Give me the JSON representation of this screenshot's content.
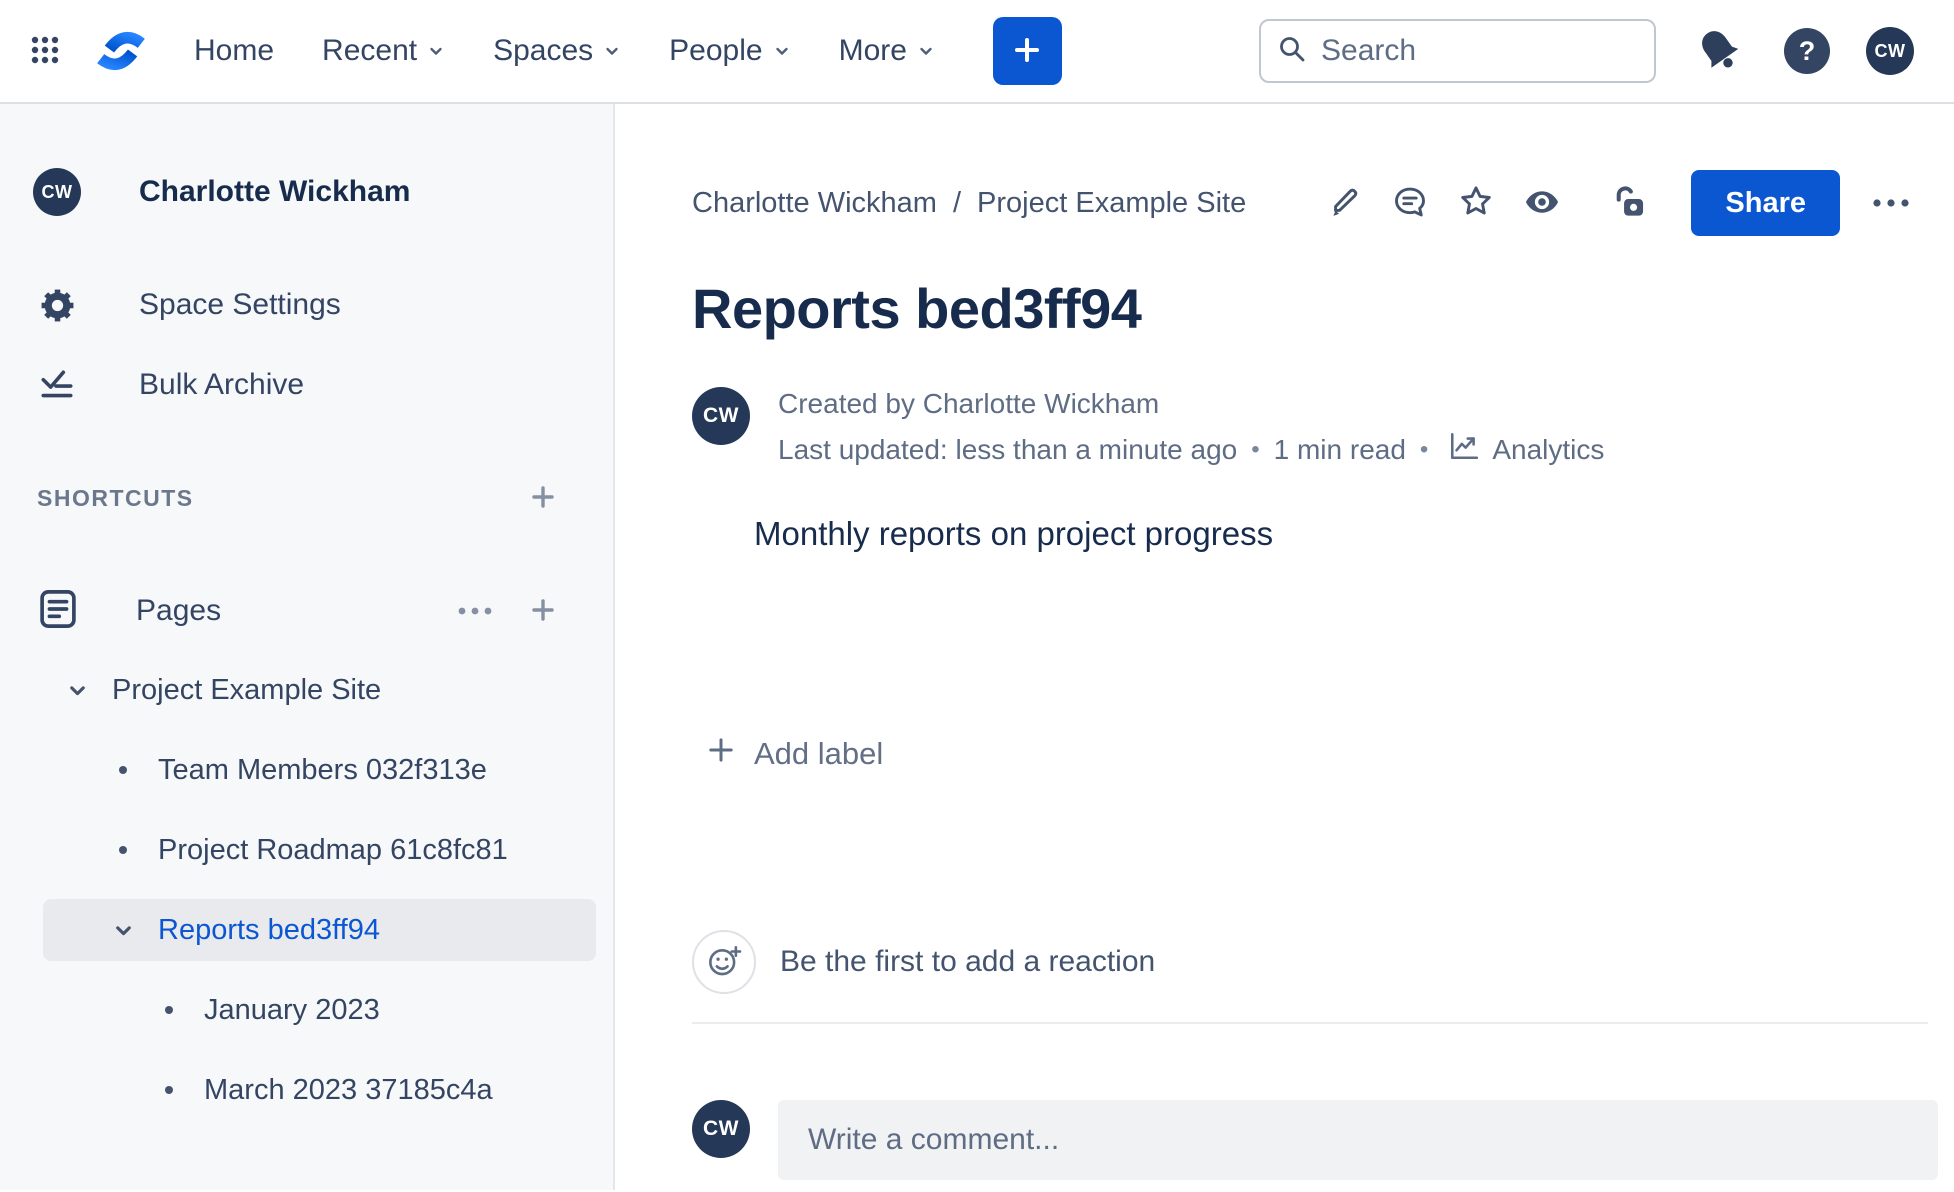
{
  "topbar": {
    "nav": [
      {
        "label": "Home",
        "dropdown": false
      },
      {
        "label": "Recent",
        "dropdown": true
      },
      {
        "label": "Spaces",
        "dropdown": true
      },
      {
        "label": "People",
        "dropdown": true
      },
      {
        "label": "More",
        "dropdown": true
      }
    ],
    "search_placeholder": "Search",
    "avatar_initials": "CW"
  },
  "sidebar": {
    "profile_name": "Charlotte Wickham",
    "avatar_initials": "CW",
    "menu": [
      {
        "label": "Space Settings"
      },
      {
        "label": "Bulk Archive"
      }
    ],
    "shortcuts_header": "SHORTCUTS",
    "pages_header": "Pages",
    "tree": [
      {
        "label": "Project Example Site"
      },
      {
        "label": "Team Members 032f313e"
      },
      {
        "label": "Project Roadmap 61c8fc81"
      },
      {
        "label": "Reports bed3ff94"
      },
      {
        "label": "January 2023"
      },
      {
        "label": "March 2023 37185c4a"
      }
    ]
  },
  "content": {
    "breadcrumb": {
      "items": [
        "Charlotte Wickham",
        "Project Example Site"
      ],
      "separator": "/"
    },
    "share_label": "Share",
    "title": "Reports bed3ff94",
    "byline": {
      "avatar_initials": "CW",
      "created": "Created by Charlotte Wickham",
      "updated": "Last updated: less than a minute ago",
      "read_time": "1 min read",
      "separator": "•",
      "analytics_label": "Analytics"
    },
    "body_text": "Monthly reports on project progress",
    "add_label": "Add label",
    "reaction_prompt": "Be the first to add a reaction",
    "comment_placeholder": "Write a comment..."
  },
  "colors": {
    "accent_blue": "#0B57D2",
    "navy_text": "#172B4D",
    "avatar_bg": "#253858",
    "sidebar_bg": "#F7F8F9",
    "muted_text": "#5E6C84"
  }
}
